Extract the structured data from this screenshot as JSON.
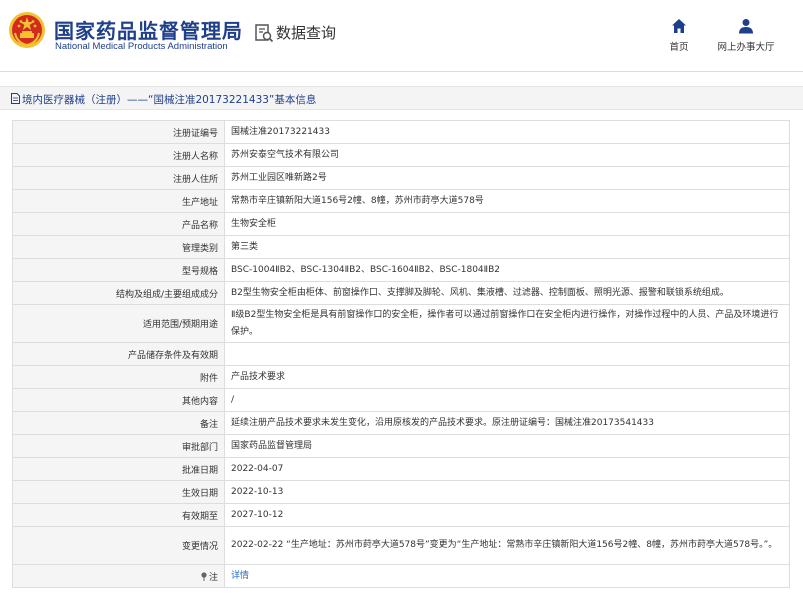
{
  "header": {
    "agency_cn": "国家药品监督管理局",
    "agency_en": "National Medical Products Administration",
    "query_title": "数据查询",
    "nav": [
      {
        "label": "首页",
        "icon": "home-icon"
      },
      {
        "label": "网上办事大厅",
        "icon": "user-icon"
      }
    ]
  },
  "breadcrumb": {
    "text": "境内医疗器械（注册）——“国械注准20173221433”基本信息",
    "icon": "document-icon"
  },
  "rows": [
    {
      "label": "注册证编号",
      "value": "国械注准20173221433"
    },
    {
      "label": "注册人名称",
      "value": "苏州安泰空气技术有限公司"
    },
    {
      "label": "注册人住所",
      "value": "苏州工业园区唯新路2号"
    },
    {
      "label": "生产地址",
      "value": "常熟市辛庄镇新阳大道156号2幢、8幢，苏州市莳亭大道578号"
    },
    {
      "label": "产品名称",
      "value": "生物安全柜"
    },
    {
      "label": "管理类别",
      "value": "第三类"
    },
    {
      "label": "型号规格",
      "value": "BSC-1004ⅡB2、BSC-1304ⅡB2、BSC-1604ⅡB2、BSC-1804ⅡB2"
    },
    {
      "label": "结构及组成/主要组成成分",
      "value": "B2型生物安全柜由柜体、前窗操作口、支撑脚及脚轮、风机、集液槽、过滤器、控制面板、照明光源、报警和联锁系统组成。"
    },
    {
      "label": "适用范围/预期用途",
      "value": "Ⅱ级B2型生物安全柜是具有前窗操作口的安全柜，操作者可以通过前窗操作口在安全柜内进行操作，对操作过程中的人员、产品及环境进行保护。"
    },
    {
      "label": "产品储存条件及有效期",
      "value": ""
    },
    {
      "label": "附件",
      "value": "产品技术要求"
    },
    {
      "label": "其他内容",
      "value": "/"
    },
    {
      "label": "备注",
      "value": "延续注册产品技术要求未发生变化，沿用原核发的产品技术要求。原注册证编号：国械注准20173541433"
    },
    {
      "label": "审批部门",
      "value": "国家药品监督管理局"
    },
    {
      "label": "批准日期",
      "value": "2022-04-07"
    },
    {
      "label": "生效日期",
      "value": "2022-10-13"
    },
    {
      "label": "有效期至",
      "value": "2027-10-12"
    },
    {
      "label": "变更情况",
      "value": "2022-02-22 “生产地址：苏州市莳亭大道578号”变更为“生产地址：常熟市辛庄镇新阳大道156号2幢、8幢，苏州市莳亭大道578号。”。"
    }
  ],
  "note_row": {
    "label": "注",
    "link": "详情",
    "icon": "note-pin-icon"
  },
  "colors": {
    "brand_blue": "#1e3f8a",
    "link_blue": "#2a6ac8",
    "emblem_red": "#d42a1e",
    "emblem_gold": "#f2c230"
  }
}
